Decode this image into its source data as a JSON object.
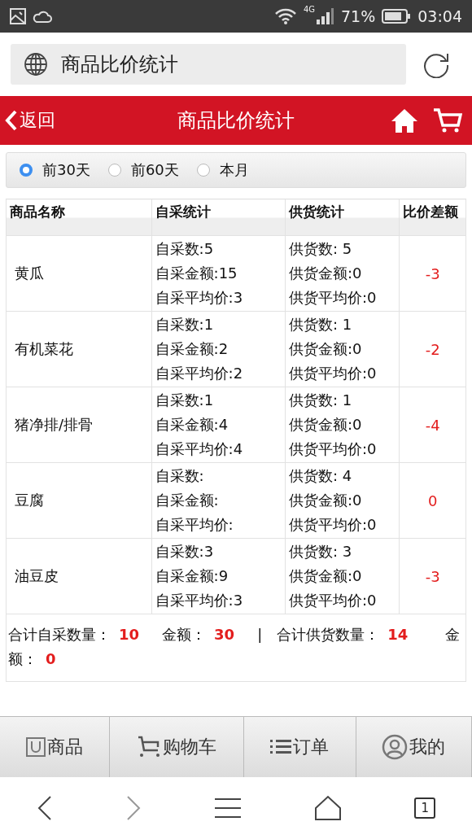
{
  "status_bar": {
    "network": "4G",
    "battery": "71%",
    "time": "03:04"
  },
  "address_bar": {
    "title": "商品比价统计"
  },
  "header": {
    "back": "返回",
    "title": "商品比价统计"
  },
  "period_options": [
    {
      "label": "前30天",
      "selected": true
    },
    {
      "label": "前60天",
      "selected": false
    },
    {
      "label": "本月",
      "selected": false
    }
  ],
  "table": {
    "columns": [
      "商品名称",
      "自采统计",
      "供货统计",
      "比价差额"
    ],
    "rows": [
      {
        "name": "黄瓜",
        "self": [
          "自采数:5",
          "自采金额:15",
          "自采平均价:3"
        ],
        "supply": [
          "供货数: 5",
          "供货金额:0",
          "供货平均价:0"
        ],
        "diff": "-3"
      },
      {
        "name": "有机菜花",
        "self": [
          "自采数:1",
          "自采金额:2",
          "自采平均价:2"
        ],
        "supply": [
          "供货数: 1",
          "供货金额:0",
          "供货平均价:0"
        ],
        "diff": "-2"
      },
      {
        "name": "猪净排/排骨",
        "self": [
          "自采数:1",
          "自采金额:4",
          "自采平均价:4"
        ],
        "supply": [
          "供货数: 1",
          "供货金额:0",
          "供货平均价:0"
        ],
        "diff": "-4"
      },
      {
        "name": "豆腐",
        "self": [
          "自采数:",
          "自采金额:",
          "自采平均价:"
        ],
        "supply": [
          "供货数: 4",
          "供货金额:0",
          "供货平均价:0"
        ],
        "diff": "0"
      },
      {
        "name": "油豆皮",
        "self": [
          "自采数:3",
          "自采金额:9",
          "自采平均价:3"
        ],
        "supply": [
          "供货数: 3",
          "供货金额:0",
          "供货平均价:0"
        ],
        "diff": "-3"
      }
    ],
    "summary": "合计自采数量：**10**　金额：**30**　|　合计供货数量：**14**　　金额：**0**"
  },
  "tab_bar": [
    {
      "kind": "goods",
      "label": "商品"
    },
    {
      "kind": "cart",
      "label": "购物车"
    },
    {
      "kind": "orders",
      "label": "订单"
    },
    {
      "kind": "me",
      "label": "我的"
    }
  ],
  "browser_nav": {
    "tabs_count": "1"
  }
}
